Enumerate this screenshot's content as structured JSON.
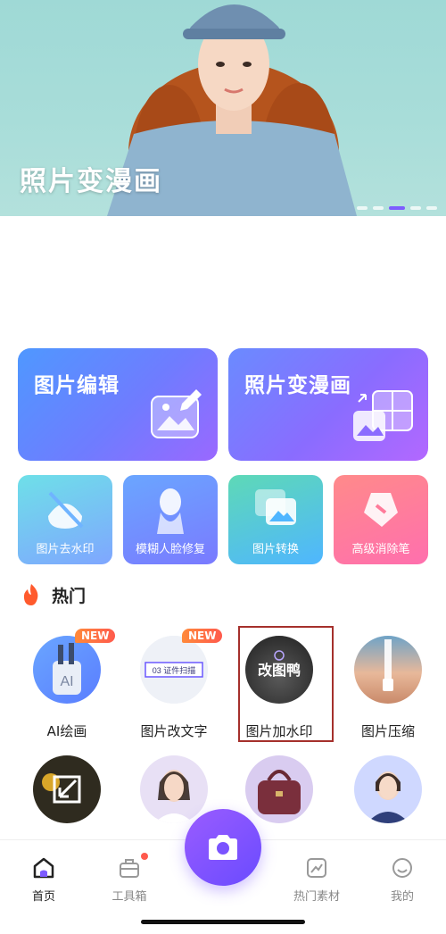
{
  "banner": {
    "title": "照片变漫画",
    "cap_text": "",
    "dots": 5,
    "active_dot": 3
  },
  "feature_cards": [
    {
      "label": "图片编辑",
      "icon": "image-edit-icon"
    },
    {
      "label": "照片变漫画",
      "icon": "image-collage-icon"
    }
  ],
  "quick_tools": [
    {
      "label": "图片去水印",
      "icon": "watermark-remove-icon"
    },
    {
      "label": "模糊人脸修复",
      "icon": "face-restore-icon"
    },
    {
      "label": "图片转换",
      "icon": "image-convert-icon"
    },
    {
      "label": "高级消除笔",
      "icon": "eraser-icon"
    }
  ],
  "section": {
    "title": "热门",
    "icon": "flame-icon"
  },
  "hot_tools": [
    {
      "label": "AI绘画",
      "badge": "NEW",
      "thumb_text": "AI"
    },
    {
      "label": "图片改文字",
      "badge": "NEW",
      "thumb_text": "03 证件扫描"
    },
    {
      "label": "图片加水印",
      "badge": "",
      "thumb_text": "改图鸭"
    },
    {
      "label": "图片压缩",
      "badge": "",
      "thumb_text": ""
    }
  ],
  "hot_tools_row2": [
    {
      "label": "",
      "thumb": "resize-icon"
    },
    {
      "label": "",
      "thumb": "portrait"
    },
    {
      "label": "",
      "thumb": "handbag"
    },
    {
      "label": "",
      "thumb": "id-photo"
    }
  ],
  "nav": {
    "items": [
      {
        "label": "首页",
        "icon": "home-icon",
        "active": true
      },
      {
        "label": "工具箱",
        "icon": "toolbox-icon",
        "active": false
      },
      {
        "label": "热门素材",
        "icon": "material-icon",
        "active": false
      },
      {
        "label": "我的",
        "icon": "profile-icon",
        "active": false
      }
    ],
    "camera": "camera-icon"
  },
  "colors": {
    "accent": "#7d5cff",
    "badge": "#ff5a4d",
    "highlight_border": "#a5302c"
  }
}
